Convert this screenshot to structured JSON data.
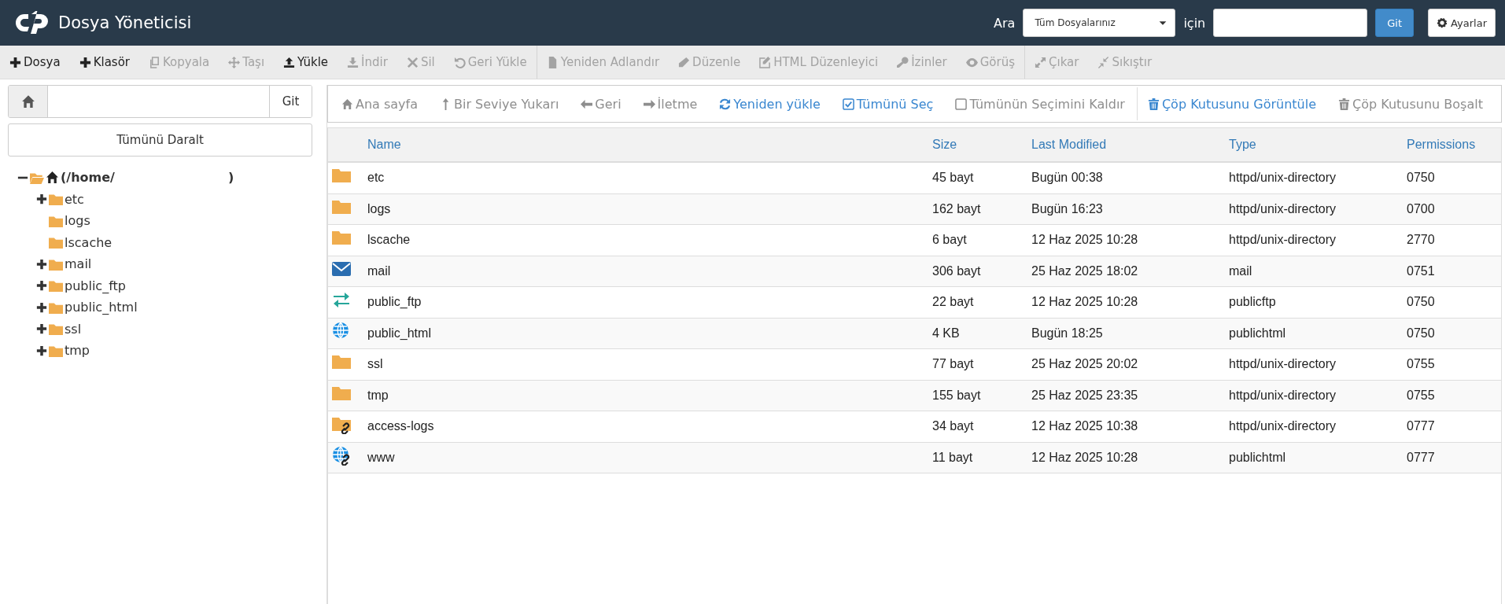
{
  "header": {
    "title": "Dosya Yöneticisi",
    "search_label": "Ara",
    "scope": "Tüm Dosyalarınız",
    "scope_suffix": "için",
    "search_button": "Git",
    "settings_button": "Ayarlar"
  },
  "toolbar": {
    "groups": [
      [
        {
          "label": "Dosya",
          "disabled": false
        },
        {
          "label": "Klasör",
          "disabled": false
        },
        {
          "label": "Kopyala",
          "disabled": true
        },
        {
          "label": "Taşı",
          "disabled": true
        },
        {
          "label": "Yükle",
          "disabled": false
        },
        {
          "label": "İndir",
          "disabled": true
        },
        {
          "label": "Sil",
          "disabled": true
        },
        {
          "label": "Geri Yükle",
          "disabled": true
        }
      ],
      [
        {
          "label": "Yeniden Adlandır",
          "disabled": true
        },
        {
          "label": "Düzenle",
          "disabled": true
        },
        {
          "label": "HTML Düzenleyici",
          "disabled": true
        },
        {
          "label": "İzinler",
          "disabled": true
        },
        {
          "label": "Görüş",
          "disabled": true
        }
      ],
      [
        {
          "label": "Çıkar",
          "disabled": true
        },
        {
          "label": "Sıkıştır",
          "disabled": true
        }
      ]
    ]
  },
  "path_bar": {
    "button": "Git"
  },
  "collapse_button": "Tümünü Daralt",
  "tree": {
    "label": "(/home/",
    "label_end": ")",
    "expanded": true,
    "children": [
      {
        "label": "etc",
        "expanded": false
      },
      {
        "label": "logs"
      },
      {
        "label": "lscache"
      },
      {
        "label": "mail",
        "expanded": false
      },
      {
        "label": "public_ftp",
        "expanded": false
      },
      {
        "label": "public_html",
        "expanded": false
      },
      {
        "label": "ssl",
        "expanded": false
      },
      {
        "label": "tmp",
        "expanded": false
      }
    ]
  },
  "nav": {
    "groups": [
      [
        {
          "label": "Ana sayfa",
          "disabled": true
        },
        {
          "label": "Bir Seviye Yukarı",
          "disabled": true
        },
        {
          "label": "Geri",
          "disabled": true
        },
        {
          "label": "İletme",
          "disabled": true
        },
        {
          "label": "Yeniden yükle",
          "disabled": false
        },
        {
          "label": "Tümünü Seç",
          "disabled": false
        },
        {
          "label": "Tümünün Seçimini Kaldır",
          "disabled": true
        }
      ],
      [
        {
          "label": "Çöp Kutusunu Görüntüle",
          "disabled": false
        },
        {
          "label": "Çöp Kutusunu Boşalt",
          "disabled": true
        }
      ]
    ]
  },
  "table": {
    "columns": [
      "Name",
      "Size",
      "Last Modified",
      "Type",
      "Permissions"
    ],
    "rows": [
      {
        "kind": "folder",
        "name": "etc",
        "size": "45 bayt",
        "modified": "Bugün 00:38",
        "type": "httpd/unix-directory",
        "permissions": "0750"
      },
      {
        "kind": "folder",
        "name": "logs",
        "size": "162 bayt",
        "modified": "Bugün 16:23",
        "type": "httpd/unix-directory",
        "permissions": "0700"
      },
      {
        "kind": "folder",
        "name": "lscache",
        "size": "6 bayt",
        "modified": "12 Haz 2025 10:28",
        "type": "httpd/unix-directory",
        "permissions": "2770"
      },
      {
        "kind": "mail",
        "name": "mail",
        "size": "306 bayt",
        "modified": "25 Haz 2025 18:02",
        "type": "mail",
        "permissions": "0751"
      },
      {
        "kind": "ftp",
        "name": "public_ftp",
        "size": "22 bayt",
        "modified": "12 Haz 2025 10:28",
        "type": "publicftp",
        "permissions": "0750"
      },
      {
        "kind": "web",
        "name": "public_html",
        "size": "4 KB",
        "modified": "Bugün 18:25",
        "type": "publichtml",
        "permissions": "0750"
      },
      {
        "kind": "folder",
        "name": "ssl",
        "size": "77 bayt",
        "modified": "25 Haz 2025 20:02",
        "type": "httpd/unix-directory",
        "permissions": "0755"
      },
      {
        "kind": "folder",
        "name": "tmp",
        "size": "155 bayt",
        "modified": "25 Haz 2025 23:35",
        "type": "httpd/unix-directory",
        "permissions": "0755"
      },
      {
        "kind": "folder-link",
        "name": "access-logs",
        "size": "34 bayt",
        "modified": "12 Haz 2025 10:38",
        "type": "httpd/unix-directory",
        "permissions": "0777"
      },
      {
        "kind": "web-link",
        "name": "www",
        "size": "11 bayt",
        "modified": "12 Haz 2025 10:28",
        "type": "publichtml",
        "permissions": "0777"
      }
    ]
  }
}
